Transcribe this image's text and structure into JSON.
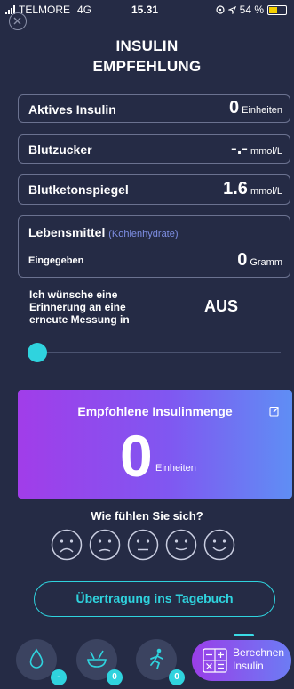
{
  "status_bar": {
    "carrier": "TELMORE",
    "network": "4G",
    "time": "15.31",
    "battery": "54 %",
    "battery_level": 0.54
  },
  "header": {
    "title_line1": "INSULIN",
    "title_line2": "EMPFEHLUNG"
  },
  "active_insulin": {
    "label": "Aktives Insulin",
    "value": "0",
    "unit": "Einheiten"
  },
  "blood_glucose": {
    "label": "Blutzucker",
    "value": "-.-",
    "unit": "mmol/L"
  },
  "ketones": {
    "label": "Blutketonspiegel",
    "value": "1.6",
    "unit": "mmol/L"
  },
  "food": {
    "label": "Lebensmittel",
    "sublabel": "(Kohlenhydrate)",
    "entered_label": "Eingegeben",
    "value": "0",
    "unit": "Gramm"
  },
  "reminder": {
    "label": "Ich wünsche eine Erinnerung an eine erneute Messung in",
    "value": "AUS",
    "slider_level": 0
  },
  "recommendation": {
    "title": "Empfohlene Insulinmenge",
    "value": "0",
    "unit": "Einheiten"
  },
  "feeling": {
    "label": "Wie fühlen Sie sich?",
    "options": [
      "very-sad-face-icon",
      "sad-face-icon",
      "neutral-face-icon",
      "content-face-icon",
      "happy-face-icon"
    ]
  },
  "transfer_button": "Übertragung ins Tagebuch",
  "bottom_nav": {
    "insulin_badge": "-",
    "food_badge": "0",
    "activity_badge": "0",
    "calc_line1": "Berechnen",
    "calc_line2": "Insulin"
  },
  "colors": {
    "background": "#252b45",
    "accent_cyan": "#2fd3de",
    "gradient_start": "#a13de9",
    "gradient_end": "#5f8ef4"
  }
}
